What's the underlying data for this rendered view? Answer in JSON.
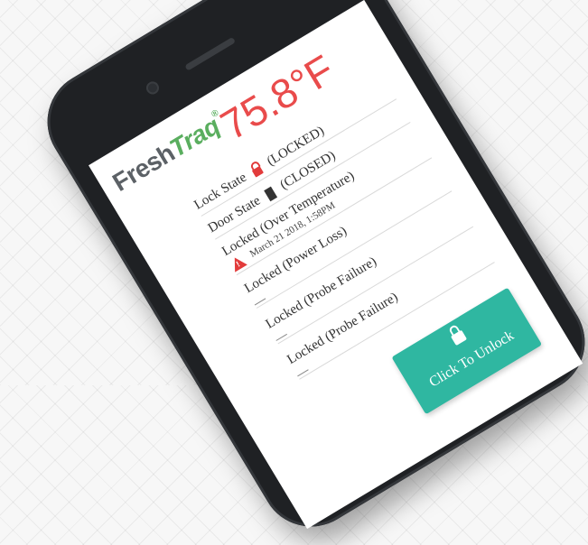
{
  "brand": {
    "fresh": "Fresh",
    "traq": "Traq",
    "reg": "®"
  },
  "temperature": "75.8°F",
  "status": {
    "lock_state_label": "Lock State",
    "lock_state_value": "(LOCKED)",
    "door_state_label": "Door State",
    "door_state_value": "(CLOSED)"
  },
  "events": [
    {
      "title": "Locked (Over Temperature)",
      "detail": "March 21 2018, 1:58PM"
    },
    {
      "title": "Locked (Power Loss)"
    },
    {
      "title": "Locked (Probe Failure)"
    },
    {
      "title": "Locked (Probe Failure)"
    }
  ],
  "unlock_button": {
    "label": "Click To Unlock"
  },
  "colors": {
    "accent": "#2fb7a1",
    "temperature": "#e94b4b",
    "brand_green": "#5aae5f",
    "alert": "#e23b3b"
  },
  "icons": [
    "lock-icon",
    "door-icon",
    "warning-icon",
    "unlock-icon"
  ]
}
